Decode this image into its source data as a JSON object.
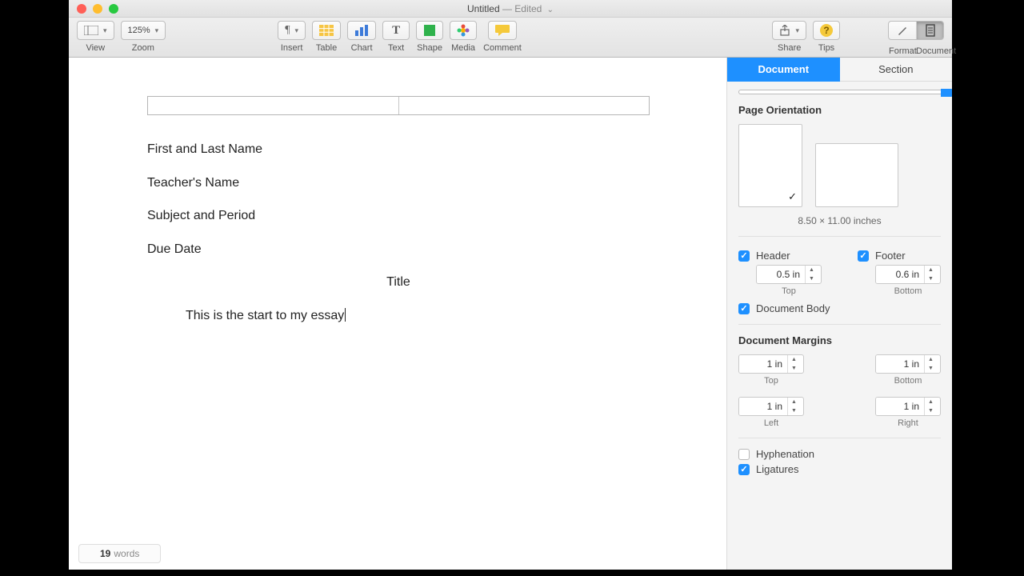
{
  "window": {
    "title": "Untitled",
    "status": "— Edited"
  },
  "toolbar": {
    "view": "View",
    "zoom_label": "Zoom",
    "zoom_value": "125%",
    "insert": "Insert",
    "table": "Table",
    "chart": "Chart",
    "text": "Text",
    "shape": "Shape",
    "media": "Media",
    "comment": "Comment",
    "share": "Share",
    "tips": "Tips",
    "format": "Format",
    "document": "Document"
  },
  "inspector": {
    "tab_document": "Document",
    "tab_section": "Section",
    "orientation_title": "Page Orientation",
    "page_size": "8.50 × 11.00 inches",
    "header_label": "Header",
    "footer_label": "Footer",
    "header_value": "0.5 in",
    "footer_value": "0.6 in",
    "header_caption": "Top",
    "footer_caption": "Bottom",
    "doc_body": "Document Body",
    "margins_title": "Document Margins",
    "margin_top": "1 in",
    "margin_bottom": "1 in",
    "margin_left": "1 in",
    "margin_right": "1 in",
    "lbl_top": "Top",
    "lbl_bottom": "Bottom",
    "lbl_left": "Left",
    "lbl_right": "Right",
    "hyphenation": "Hyphenation",
    "ligatures": "Ligatures"
  },
  "document": {
    "line1": "First and Last Name",
    "line2": "Teacher's Name",
    "line3": "Subject and Period",
    "line4": "Due Date",
    "title": "Title",
    "body": "This is the start to my essay"
  },
  "wordcount": {
    "count": "19",
    "label": "words"
  }
}
